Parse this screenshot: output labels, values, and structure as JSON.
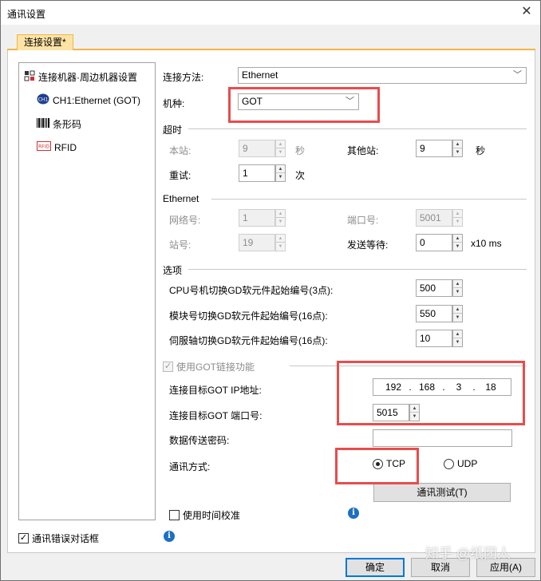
{
  "window": {
    "title": "通讯设置",
    "close_symbol": "✕"
  },
  "tab": {
    "label": "连接设置*"
  },
  "tree": {
    "root": {
      "label": "连接机器·周边机器设置",
      "icon": "network-device-icon"
    },
    "items": [
      {
        "label": "CH1:Ethernet (GOT)",
        "icon": "channel-icon"
      },
      {
        "label": "条形码",
        "icon": "barcode-icon"
      },
      {
        "label": "RFID",
        "icon": "rfid-icon"
      }
    ]
  },
  "connection": {
    "method_label": "连接方法:",
    "method_value": "Ethernet",
    "model_label": "机种:",
    "model_value": "GOT"
  },
  "timeout": {
    "group": "超时",
    "station_label": "本站:",
    "station_value": "9",
    "station_unit": "秒",
    "other_label": "其他站:",
    "other_value": "9",
    "other_unit": "秒",
    "retry_label": "重试:",
    "retry_value": "1",
    "retry_unit": "次"
  },
  "ethernet": {
    "group": "Ethernet",
    "network_label": "网络号:",
    "network_value": "1",
    "port_label": "端口号:",
    "port_value": "5001",
    "station_label": "站号:",
    "station_value": "19",
    "wait_label": "发送等待:",
    "wait_value": "0",
    "wait_unit": "x10 ms"
  },
  "options": {
    "group": "选项",
    "rows": [
      {
        "label": "CPU号机切换GD软元件起始编号(3点):",
        "value": "500"
      },
      {
        "label": "模块号切换GD软元件起始编号(16点):",
        "value": "550"
      },
      {
        "label": "伺服轴切换GD软元件起始编号(16点):",
        "value": "10"
      }
    ]
  },
  "got_link": {
    "checkbox_label": "使用GOT链接功能",
    "ip_label": "连接目标GOT IP地址:",
    "ip": [
      "192",
      "168",
      "3",
      "18"
    ],
    "port_label": "连接目标GOT 端口号:",
    "port_value": "5015",
    "password_label": "数据传送密码:",
    "password_value": "",
    "comm_label": "通讯方式:",
    "tcp_label": "TCP",
    "udp_label": "UDP",
    "test_button": "通讯测试(T)",
    "time_sync_label": "使用时间校准"
  },
  "footer": {
    "error_dialog_label": "通讯错误对话框",
    "ok": "确定",
    "cancel": "取消",
    "apply": "应用(A)"
  },
  "watermark": "知乎 @纸团人",
  "colors": {
    "highlight": "#e84c4c",
    "tab_accent": "#f2b544",
    "default_button": "#0078d7",
    "info": "#1e6fc4"
  }
}
